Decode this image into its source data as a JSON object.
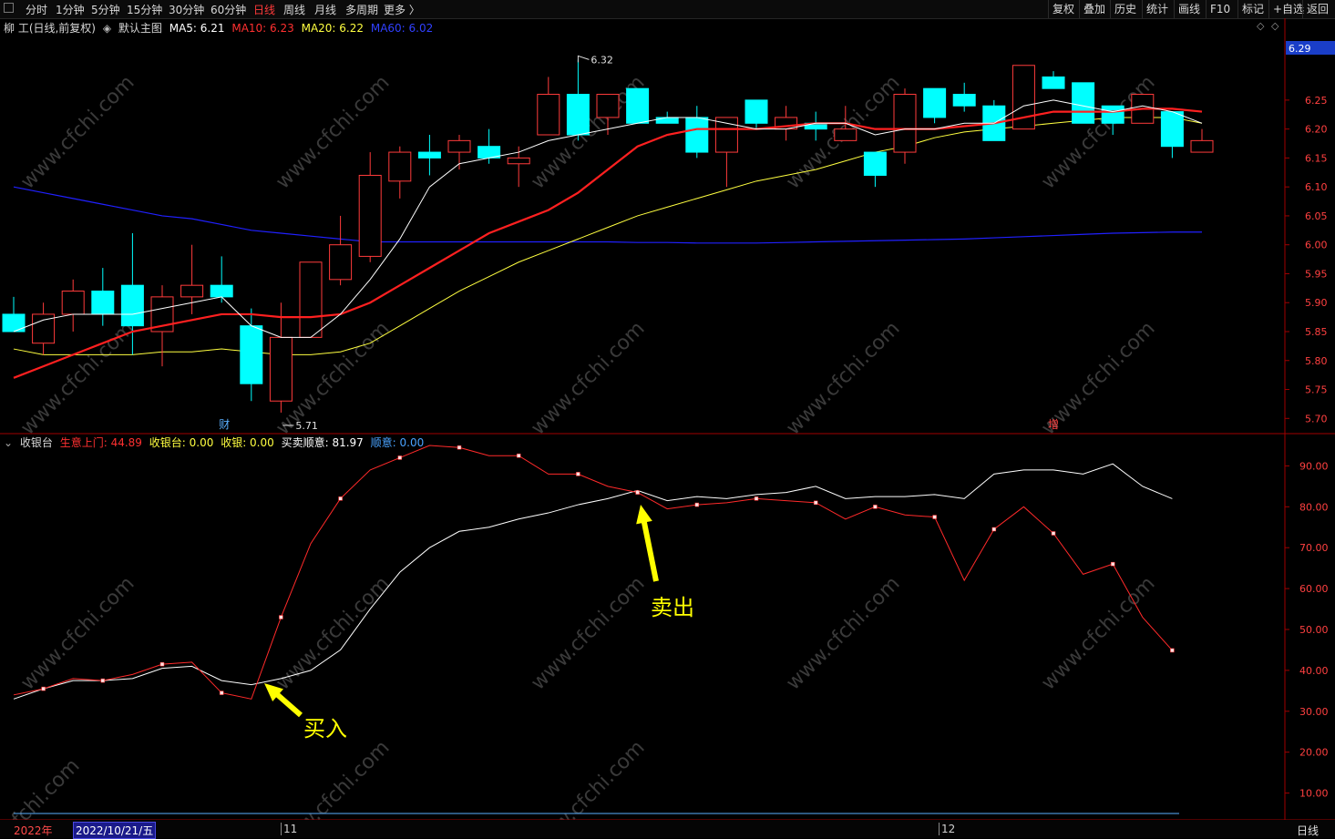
{
  "toolbar": {
    "periods": [
      {
        "label": "分时",
        "active": false
      },
      {
        "label": "1分钟",
        "active": false
      },
      {
        "label": "5分钟",
        "active": false
      },
      {
        "label": "15分钟",
        "active": false
      },
      {
        "label": "30分钟",
        "active": false
      },
      {
        "label": "60分钟",
        "active": false
      },
      {
        "label": "日线",
        "active": true
      },
      {
        "label": "周线",
        "active": false
      },
      {
        "label": "月线",
        "active": false
      },
      {
        "label": "多周期",
        "active": false
      },
      {
        "label": "更多 〉",
        "active": false
      }
    ],
    "right_buttons": [
      "复权",
      "叠加",
      "历史",
      "统计",
      "画线",
      "F10",
      "标记",
      "+自选",
      "返回"
    ]
  },
  "main_legend": {
    "stock": "柳 工(日线,前复权)",
    "chart_name": "默认主图",
    "ma5": "MA5: 6.21",
    "ma10": "MA10: 6.23",
    "ma20": "MA20: 6.22",
    "ma60": "MA60: 6.02"
  },
  "colors": {
    "up": "#ff3b3b",
    "down": "#00ffff",
    "ma5": "#ffffff",
    "ma10": "#ff2020",
    "ma20": "#ffff40",
    "ma60": "#2020ff",
    "accent_red": "#c00000",
    "annotation_yellow": "#ffff00"
  },
  "current_price": "6.29",
  "markers": {
    "high": "6.32",
    "low": "5.71",
    "cai": "财",
    "zeng": "增"
  },
  "sub_legend": {
    "name": "收银台",
    "l1": "生意上门: 44.89",
    "l2": "收银台: 0.00",
    "l3": "收银: 0.00",
    "l4": "买卖顺意: 81.97",
    "l5": "顺意: 0.00"
  },
  "annotations": {
    "buy": "买入",
    "sell": "卖出"
  },
  "bottom": {
    "year": "2022年",
    "date": "2022/10/21/五",
    "m11": "11",
    "m12": "12",
    "period": "日线"
  },
  "watermark": "www.cfchi.com",
  "chart_data": [
    {
      "type": "candlestick",
      "title": "柳 工(日线,前复权)",
      "ylim": [
        5.68,
        6.36
      ],
      "y_ticks": [
        "6.25",
        "6.20",
        "6.15",
        "6.10",
        "6.05",
        "6.00",
        "5.95",
        "5.90",
        "5.85",
        "5.80",
        "5.75",
        "5.70"
      ],
      "candles": [
        {
          "o": 5.88,
          "h": 5.91,
          "l": 5.85,
          "c": 5.85
        },
        {
          "o": 5.83,
          "h": 5.9,
          "l": 5.81,
          "c": 5.88
        },
        {
          "o": 5.88,
          "h": 5.94,
          "l": 5.85,
          "c": 5.92
        },
        {
          "o": 5.92,
          "h": 5.96,
          "l": 5.86,
          "c": 5.88
        },
        {
          "o": 5.93,
          "h": 6.02,
          "l": 5.81,
          "c": 5.86
        },
        {
          "o": 5.85,
          "h": 5.93,
          "l": 5.79,
          "c": 5.91
        },
        {
          "o": 5.91,
          "h": 6.0,
          "l": 5.88,
          "c": 5.93
        },
        {
          "o": 5.93,
          "h": 5.98,
          "l": 5.9,
          "c": 5.91
        },
        {
          "o": 5.86,
          "h": 5.89,
          "l": 5.73,
          "c": 5.76
        },
        {
          "o": 5.73,
          "h": 5.9,
          "l": 5.71,
          "c": 5.84
        },
        {
          "o": 5.84,
          "h": 5.97,
          "l": 5.84,
          "c": 5.97
        },
        {
          "o": 5.94,
          "h": 6.05,
          "l": 5.93,
          "c": 6.0
        },
        {
          "o": 5.98,
          "h": 6.16,
          "l": 5.97,
          "c": 6.12
        },
        {
          "o": 6.11,
          "h": 6.17,
          "l": 6.08,
          "c": 6.16
        },
        {
          "o": 6.16,
          "h": 6.19,
          "l": 6.12,
          "c": 6.15
        },
        {
          "o": 6.16,
          "h": 6.19,
          "l": 6.13,
          "c": 6.18
        },
        {
          "o": 6.17,
          "h": 6.2,
          "l": 6.14,
          "c": 6.15
        },
        {
          "o": 6.14,
          "h": 6.17,
          "l": 6.1,
          "c": 6.15
        },
        {
          "o": 6.19,
          "h": 6.29,
          "l": 6.19,
          "c": 6.26
        },
        {
          "o": 6.26,
          "h": 6.32,
          "l": 6.18,
          "c": 6.19
        },
        {
          "o": 6.22,
          "h": 6.26,
          "l": 6.19,
          "c": 6.26
        },
        {
          "o": 6.27,
          "h": 6.27,
          "l": 6.21,
          "c": 6.21
        },
        {
          "o": 6.22,
          "h": 6.23,
          "l": 6.21,
          "c": 6.21
        },
        {
          "o": 6.22,
          "h": 6.24,
          "l": 6.15,
          "c": 6.16
        },
        {
          "o": 6.16,
          "h": 6.22,
          "l": 6.1,
          "c": 6.22
        },
        {
          "o": 6.25,
          "h": 6.25,
          "l": 6.2,
          "c": 6.21
        },
        {
          "o": 6.2,
          "h": 6.24,
          "l": 6.18,
          "c": 6.22
        },
        {
          "o": 6.21,
          "h": 6.23,
          "l": 6.18,
          "c": 6.2
        },
        {
          "o": 6.18,
          "h": 6.24,
          "l": 6.18,
          "c": 6.2
        },
        {
          "o": 6.16,
          "h": 6.16,
          "l": 6.1,
          "c": 6.12
        },
        {
          "o": 6.16,
          "h": 6.27,
          "l": 6.14,
          "c": 6.26
        },
        {
          "o": 6.27,
          "h": 6.27,
          "l": 6.21,
          "c": 6.22
        },
        {
          "o": 6.26,
          "h": 6.28,
          "l": 6.23,
          "c": 6.24
        },
        {
          "o": 6.24,
          "h": 6.25,
          "l": 6.18,
          "c": 6.18
        },
        {
          "o": 6.2,
          "h": 6.31,
          "l": 6.2,
          "c": 6.31
        },
        {
          "o": 6.29,
          "h": 6.3,
          "l": 6.27,
          "c": 6.27
        },
        {
          "o": 6.28,
          "h": 6.28,
          "l": 6.21,
          "c": 6.21
        },
        {
          "o": 6.24,
          "h": 6.24,
          "l": 6.19,
          "c": 6.21
        },
        {
          "o": 6.21,
          "h": 6.26,
          "l": 6.21,
          "c": 6.26
        },
        {
          "o": 6.23,
          "h": 6.23,
          "l": 6.15,
          "c": 6.17
        },
        {
          "o": 6.16,
          "h": 6.2,
          "l": 6.16,
          "c": 6.18
        }
      ],
      "ma5": [
        5.85,
        5.87,
        5.88,
        5.88,
        5.88,
        5.89,
        5.9,
        5.91,
        5.86,
        5.84,
        5.84,
        5.88,
        5.94,
        6.01,
        6.1,
        6.14,
        6.15,
        6.16,
        6.18,
        6.19,
        6.2,
        6.21,
        6.22,
        6.22,
        6.21,
        6.2,
        6.2,
        6.21,
        6.21,
        6.19,
        6.2,
        6.2,
        6.21,
        6.21,
        6.24,
        6.25,
        6.24,
        6.23,
        6.24,
        6.23,
        6.21
      ],
      "ma10": [
        5.77,
        5.79,
        5.81,
        5.83,
        5.85,
        5.86,
        5.87,
        5.88,
        5.88,
        5.875,
        5.875,
        5.88,
        5.9,
        5.93,
        5.96,
        5.99,
        6.02,
        6.04,
        6.06,
        6.09,
        6.13,
        6.17,
        6.19,
        6.2,
        6.2,
        6.2,
        6.205,
        6.21,
        6.21,
        6.2,
        6.2,
        6.2,
        6.205,
        6.21,
        6.22,
        6.23,
        6.23,
        6.23,
        6.235,
        6.235,
        6.23
      ],
      "ma20": [
        5.82,
        5.81,
        5.81,
        5.81,
        5.81,
        5.815,
        5.815,
        5.82,
        5.815,
        5.81,
        5.81,
        5.815,
        5.83,
        5.86,
        5.89,
        5.92,
        5.945,
        5.97,
        5.99,
        6.01,
        6.03,
        6.05,
        6.065,
        6.08,
        6.095,
        6.11,
        6.12,
        6.13,
        6.145,
        6.16,
        6.17,
        6.185,
        6.195,
        6.2,
        6.205,
        6.21,
        6.215,
        6.22,
        6.22,
        6.22,
        6.21
      ],
      "ma60": [
        6.1,
        6.09,
        6.08,
        6.07,
        6.06,
        6.05,
        6.045,
        6.035,
        6.025,
        6.02,
        6.015,
        6.01,
        6.005,
        6.005,
        6.005,
        6.005,
        6.005,
        6.005,
        6.005,
        6.005,
        6.005,
        6.004,
        6.004,
        6.003,
        6.003,
        6.003,
        6.004,
        6.005,
        6.006,
        6.007,
        6.008,
        6.009,
        6.01,
        6.012,
        6.014,
        6.016,
        6.018,
        6.02,
        6.021,
        6.022,
        6.022
      ]
    },
    {
      "type": "line",
      "title": "收银台",
      "ylim": [
        5,
        97
      ],
      "y_ticks": [
        "90.00",
        "80.00",
        "70.00",
        "60.00",
        "50.00",
        "40.00",
        "30.00",
        "20.00",
        "10.00"
      ],
      "series": [
        {
          "name": "生意上门",
          "values": [
            34,
            35.5,
            38,
            37.5,
            39,
            41.5,
            42,
            34.5,
            33,
            53,
            71,
            82,
            89,
            92,
            95,
            94.5,
            92.5,
            92.5,
            88,
            88,
            85,
            83.5,
            79.5,
            80.5,
            81,
            82,
            81.5,
            81,
            77,
            80,
            78,
            77.5,
            62,
            74.5,
            80,
            73.5,
            63.5,
            66,
            53,
            44.89
          ]
        },
        {
          "name": "买卖顺意",
          "values": [
            33,
            35.5,
            37.5,
            37.5,
            38,
            40.5,
            41,
            37.5,
            36.5,
            38,
            40,
            45,
            55,
            64,
            70,
            74,
            75,
            77,
            78.5,
            80.5,
            82,
            84,
            81.5,
            82.5,
            82,
            83,
            83.5,
            85,
            82,
            82.5,
            82.5,
            83,
            82,
            88,
            89,
            89,
            88,
            90.5,
            85,
            81.97
          ]
        }
      ]
    }
  ]
}
